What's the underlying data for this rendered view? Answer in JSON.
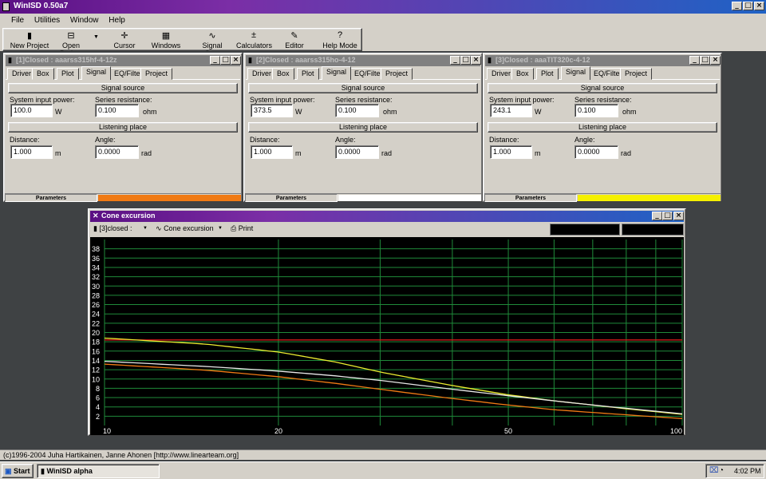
{
  "app": {
    "title": "WinISD 0.50a7"
  },
  "menu": [
    "File",
    "Utilities",
    "Window",
    "Help"
  ],
  "toolbar": {
    "new_project": "New Project",
    "open_project": "Open Project",
    "cursor": "Cursor",
    "windows": "Windows",
    "signal_gen": "Signal Gen.",
    "calculators": "Calculators",
    "editor": "Editor",
    "help_mode": "Help Mode"
  },
  "tabs": [
    "Driver",
    "Box",
    "Plot",
    "Signal",
    "EQ/Filter",
    "Project"
  ],
  "labels": {
    "signal_source": "Signal source",
    "system_input_power": "System input power:",
    "series_resistance": "Series resistance:",
    "listening_place": "Listening place",
    "distance": "Distance:",
    "angle": "Angle:",
    "unit_w": "W",
    "unit_ohm": "ohm",
    "unit_m": "m",
    "unit_rad": "rad",
    "parameters": "Parameters"
  },
  "projects": [
    {
      "title": "[1]Closed : aaarss315hf-4-12z",
      "power": "100.0",
      "resistance": "0.100",
      "distance": "1.000",
      "angle": "0.0000",
      "status_color": "#f07a14"
    },
    {
      "title": "[2]Closed : aaarss315ho-4-12",
      "power": "373.5",
      "resistance": "0.100",
      "distance": "1.000",
      "angle": "0.0000",
      "status_color": "#ffffff"
    },
    {
      "title": "[3]Closed : aaaTIT320c-4-12",
      "power": "243.1",
      "resistance": "0.100",
      "distance": "1.000",
      "angle": "0.0000",
      "status_color": "#f5f000"
    }
  ],
  "plot_window": {
    "title": "Cone excursion",
    "project_select": "[3]closed :",
    "plot_select": "Cone excursion",
    "print": "Print"
  },
  "chart_data": {
    "type": "line",
    "x_scale": "log",
    "xlim": [
      10,
      100
    ],
    "ylim": [
      0,
      40
    ],
    "x_ticks": [
      10,
      20,
      50,
      100
    ],
    "y_ticks": [
      2,
      4,
      6,
      8,
      10,
      12,
      14,
      16,
      18,
      20,
      22,
      24,
      26,
      28,
      30,
      32,
      34,
      36,
      38
    ],
    "grid": true,
    "series": [
      {
        "color": "#d21a1a",
        "x": [
          10,
          100
        ],
        "values": [
          18.4,
          18.4
        ]
      },
      {
        "color": "#ecec30",
        "x": [
          10,
          15,
          20,
          25,
          30,
          40,
          50,
          60,
          70,
          80,
          100
        ],
        "values": [
          18.8,
          17.5,
          15.8,
          13.7,
          11.5,
          8.6,
          6.6,
          5.3,
          4.4,
          3.6,
          2.4
        ]
      },
      {
        "color": "#e8e8e8",
        "x": [
          10,
          15,
          20,
          25,
          30,
          40,
          50,
          60,
          70,
          80,
          100
        ],
        "values": [
          13.8,
          12.7,
          11.7,
          10.7,
          9.7,
          7.8,
          6.4,
          5.3,
          4.4,
          3.7,
          2.5
        ]
      },
      {
        "color": "#f07a14",
        "x": [
          10,
          15,
          20,
          25,
          30,
          40,
          50,
          60,
          70,
          80,
          100
        ],
        "values": [
          13.2,
          11.9,
          10.5,
          9.1,
          7.8,
          5.8,
          4.4,
          3.4,
          2.8,
          2.3,
          1.5
        ]
      }
    ]
  },
  "footer": {
    "copyright": "(c)1996-2004 Juha Hartikainen, Janne Ahonen [http://www.linearteam.org]"
  },
  "taskbar": {
    "start": "Start",
    "task": "WinISD alpha",
    "time": "4:02 PM"
  }
}
